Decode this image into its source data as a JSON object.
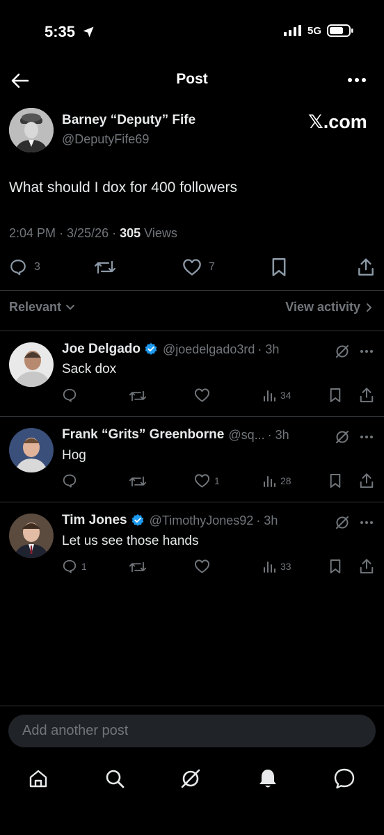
{
  "status_bar": {
    "time": "5:35",
    "network": "5G"
  },
  "header": {
    "title": "Post"
  },
  "post": {
    "author_name": "Barney “Deputy” Fife",
    "handle": "@DeputyFife69",
    "brand": "𝕏.com",
    "text": "What should I dox for 400 followers",
    "time": "2:04 PM · 3/25/26 · ",
    "views_count": "305",
    "views_label": " Views",
    "replies": "3",
    "likes": "7"
  },
  "filters": {
    "relevant": "Relevant",
    "view_activity": "View activity"
  },
  "replies": [
    {
      "name": "Joe Delgado",
      "handle": "@joedelgado3rd",
      "time": "· 3h",
      "text": "Sack dox",
      "reply_count": "",
      "like_count": "",
      "views": "34",
      "verified": true
    },
    {
      "name": "Frank “Grits” Greenborne",
      "handle": "@sq...",
      "time": "· 3h",
      "text": "Hog",
      "reply_count": "",
      "like_count": "1",
      "views": "28",
      "verified": false
    },
    {
      "name": "Tim Jones",
      "handle": "@TimothyJones92",
      "time": "· 3h",
      "text": "Let us see those hands",
      "reply_count": "1",
      "like_count": "",
      "views": "33",
      "verified": true
    }
  ],
  "compose": {
    "placeholder": "Add another post"
  },
  "colors": {
    "background": "#000000",
    "text": "#e7e9ea",
    "muted": "#71767b",
    "verified": "#1d9bf0",
    "divider": "#2f3336"
  },
  "icons": [
    "back-arrow-icon",
    "more-icon",
    "reply-icon",
    "retweet-icon",
    "like-icon",
    "bookmark-icon",
    "share-icon",
    "views-icon",
    "grok-icon",
    "home-icon",
    "search-icon",
    "bell-icon",
    "messages-icon"
  ]
}
